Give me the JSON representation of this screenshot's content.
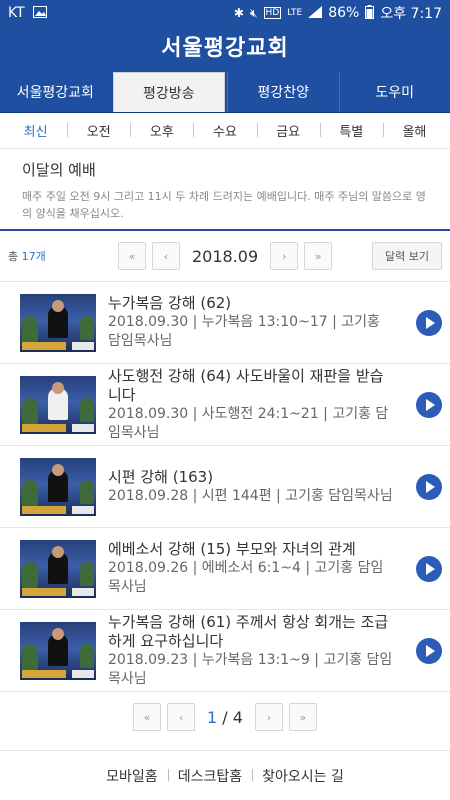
{
  "status": {
    "carrier": "KT",
    "battery": "86%",
    "time": "오후 7:17",
    "icons": [
      "image-icon",
      "bluetooth-icon",
      "mute-icon",
      "hd-icon",
      "lte-icon",
      "signal-icon",
      "battery-icon"
    ]
  },
  "header": {
    "logo": "서울평강교회"
  },
  "main_tabs": [
    {
      "label": "서울평강교회"
    },
    {
      "label": "평강방송"
    },
    {
      "label": "평강찬양"
    },
    {
      "label": "도우미"
    }
  ],
  "sub_tabs": [
    {
      "label": "최신"
    },
    {
      "label": "오전"
    },
    {
      "label": "오후"
    },
    {
      "label": "수요"
    },
    {
      "label": "금요"
    },
    {
      "label": "특별"
    },
    {
      "label": "올해"
    }
  ],
  "section": {
    "title": "이달의 예배",
    "desc": "매주 주일 오전 9시 그리고 11시 두 차례 드려지는 예배입니다. 매주 주님의 말씀으로 영의 양식을 채우십시오."
  },
  "controls": {
    "total_prefix": "총",
    "total_count": "17개",
    "first": "«",
    "prev": "‹",
    "month": "2018.09",
    "next": "›",
    "last": "»",
    "calendar": "달력 보기"
  },
  "items": [
    {
      "title": "누가복음 강해 (62)",
      "meta": "2018.09.30 | 누가복음 13:10~17 | 고기홍 담임목사님"
    },
    {
      "title": "사도행전 강해 (64) 사도바울이 재판을 받습니다",
      "meta": "2018.09.30 | 사도행전 24:1~21 | 고기홍 담임목사님"
    },
    {
      "title": "시편 강해 (163)",
      "meta": "2018.09.28 | 시편 144편 | 고기홍 담임목사님"
    },
    {
      "title": "에베소서 강해 (15) 부모와 자녀의 관계",
      "meta": "2018.09.26 | 에베소서 6:1~4 | 고기홍 담임목사님"
    },
    {
      "title": "누가복음 강해 (61) 주께서 항상 회개는 조급하게 요구하십니다",
      "meta": "2018.09.23 | 누가복음 13:1~9 | 고기홍 담임목사님"
    }
  ],
  "pagination": {
    "first": "«",
    "prev": "‹",
    "current": "1",
    "sep": "/",
    "total": "4",
    "next": "›",
    "last": "»"
  },
  "footer": [
    {
      "label": "모바일홈"
    },
    {
      "label": "데스크탑홈"
    },
    {
      "label": "찾아오시는 길"
    }
  ]
}
